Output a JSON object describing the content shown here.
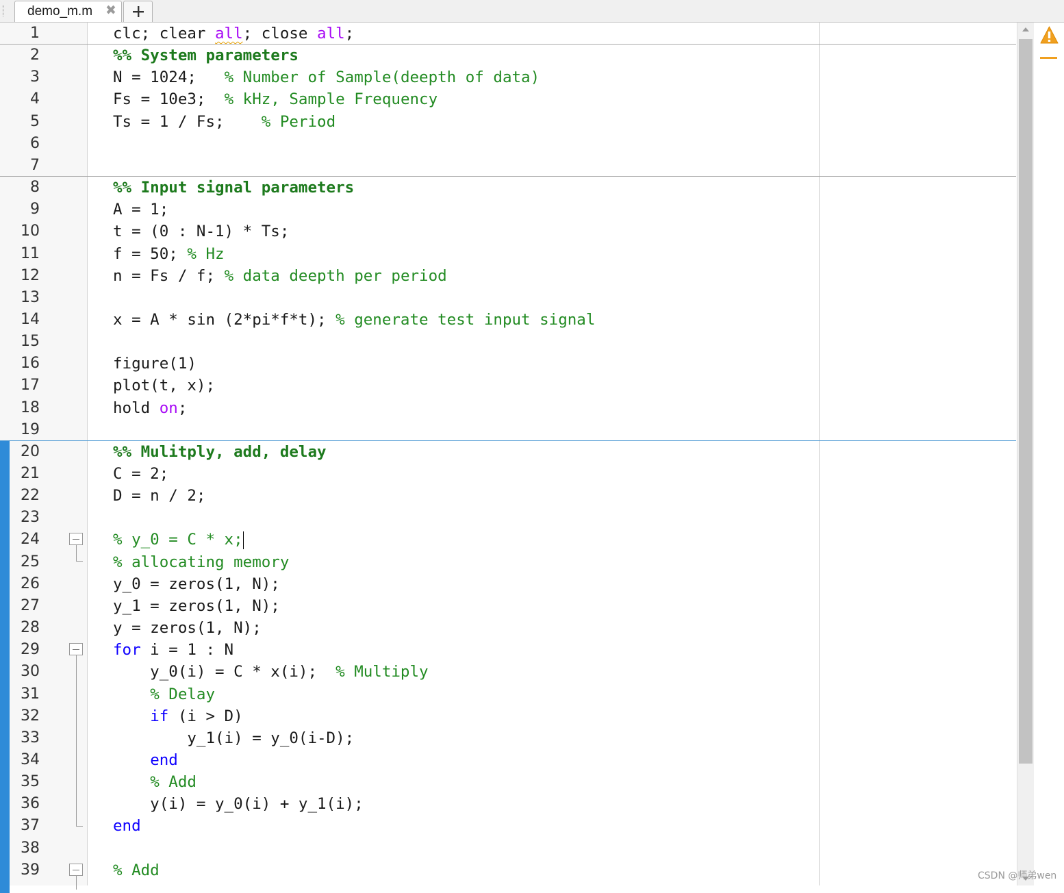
{
  "tab": {
    "title": "demo_m.m",
    "close_glyph": "✖",
    "add_icon": "plus-icon"
  },
  "editor": {
    "lines": [
      {
        "n": "1",
        "tokens": [
          [
            "plain",
            "clc; clear "
          ],
          [
            "str-squig",
            "all"
          ],
          [
            "plain",
            "; close "
          ],
          [
            "str",
            "all"
          ],
          [
            "plain",
            ";"
          ]
        ]
      },
      {
        "n": "2",
        "tokens": [
          [
            "sec",
            "%% System parameters"
          ]
        ]
      },
      {
        "n": "3",
        "tokens": [
          [
            "plain",
            "N = 1024;   "
          ],
          [
            "cm",
            "% Number of Sample(deepth of data)"
          ]
        ]
      },
      {
        "n": "4",
        "tokens": [
          [
            "plain",
            "Fs = 10e3;  "
          ],
          [
            "cm",
            "% kHz, Sample Frequency"
          ]
        ]
      },
      {
        "n": "5",
        "tokens": [
          [
            "plain",
            "Ts = 1 / Fs;    "
          ],
          [
            "cm",
            "% Period"
          ]
        ]
      },
      {
        "n": "6",
        "tokens": []
      },
      {
        "n": "7",
        "tokens": []
      },
      {
        "n": "8",
        "tokens": [
          [
            "sec",
            "%% Input signal parameters"
          ]
        ]
      },
      {
        "n": "9",
        "tokens": [
          [
            "plain",
            "A = 1;"
          ]
        ]
      },
      {
        "n": "10",
        "tokens": [
          [
            "plain",
            "t = (0 : N-1) * Ts;"
          ]
        ]
      },
      {
        "n": "11",
        "tokens": [
          [
            "plain",
            "f = 50; "
          ],
          [
            "cm",
            "% Hz"
          ]
        ]
      },
      {
        "n": "12",
        "tokens": [
          [
            "plain",
            "n = Fs / f; "
          ],
          [
            "cm",
            "% data deepth per period"
          ]
        ]
      },
      {
        "n": "13",
        "tokens": []
      },
      {
        "n": "14",
        "tokens": [
          [
            "plain",
            "x = A * sin (2*pi*f*t); "
          ],
          [
            "cm",
            "% generate test input signal"
          ]
        ]
      },
      {
        "n": "15",
        "tokens": []
      },
      {
        "n": "16",
        "tokens": [
          [
            "plain",
            "figure(1)"
          ]
        ]
      },
      {
        "n": "17",
        "tokens": [
          [
            "plain",
            "plot(t, x);"
          ]
        ]
      },
      {
        "n": "18",
        "tokens": [
          [
            "plain",
            "hold "
          ],
          [
            "str",
            "on"
          ],
          [
            "plain",
            ";"
          ]
        ]
      },
      {
        "n": "19",
        "tokens": []
      },
      {
        "n": "20",
        "tokens": [
          [
            "sec",
            "%% Mulitply, add, delay"
          ]
        ]
      },
      {
        "n": "21",
        "tokens": [
          [
            "plain",
            "C = 2;"
          ]
        ]
      },
      {
        "n": "22",
        "tokens": [
          [
            "plain",
            "D = n / 2;"
          ]
        ]
      },
      {
        "n": "23",
        "tokens": []
      },
      {
        "n": "24",
        "tokens": [
          [
            "cm",
            "% y_0 = C * x;"
          ],
          [
            "caret",
            ""
          ]
        ]
      },
      {
        "n": "25",
        "tokens": [
          [
            "cm",
            "% allocating memory"
          ]
        ]
      },
      {
        "n": "26",
        "tokens": [
          [
            "plain",
            "y_0 = zeros(1, N);"
          ]
        ]
      },
      {
        "n": "27",
        "tokens": [
          [
            "plain",
            "y_1 = zeros(1, N);"
          ]
        ]
      },
      {
        "n": "28",
        "tokens": [
          [
            "plain",
            "y = zeros(1, N);"
          ]
        ]
      },
      {
        "n": "29",
        "tokens": [
          [
            "kw",
            "for"
          ],
          [
            "plain",
            " i = 1 : N"
          ]
        ]
      },
      {
        "n": "30",
        "tokens": [
          [
            "plain",
            "    y_0(i) = C * x(i);  "
          ],
          [
            "cm",
            "% Multiply"
          ]
        ]
      },
      {
        "n": "31",
        "tokens": [
          [
            "plain",
            "    "
          ],
          [
            "cm",
            "% Delay"
          ]
        ]
      },
      {
        "n": "32",
        "tokens": [
          [
            "plain",
            "    "
          ],
          [
            "kw",
            "if"
          ],
          [
            "plain",
            " (i > D)"
          ]
        ]
      },
      {
        "n": "33",
        "tokens": [
          [
            "plain",
            "        y_1(i) = y_0(i-D);"
          ]
        ]
      },
      {
        "n": "34",
        "tokens": [
          [
            "plain",
            "    "
          ],
          [
            "kw",
            "end"
          ]
        ]
      },
      {
        "n": "35",
        "tokens": [
          [
            "plain",
            "    "
          ],
          [
            "cm",
            "% Add"
          ]
        ]
      },
      {
        "n": "36",
        "tokens": [
          [
            "plain",
            "    y(i) = y_0(i) + y_1(i);"
          ]
        ]
      },
      {
        "n": "37",
        "tokens": [
          [
            "kw",
            "end"
          ]
        ]
      },
      {
        "n": "38",
        "tokens": []
      },
      {
        "n": "39",
        "tokens": [
          [
            "cm",
            "% Add"
          ]
        ]
      }
    ],
    "colors": {
      "keyword": "#0e00ff",
      "string": "#a709f5",
      "comment": "#228b22",
      "section": "#1d7a1d",
      "changebar": "#2e8bd8",
      "warning": "#f0a020"
    }
  },
  "message_panel": {
    "icon": "warning-icon"
  },
  "watermark": "CSDN @师弟wen"
}
